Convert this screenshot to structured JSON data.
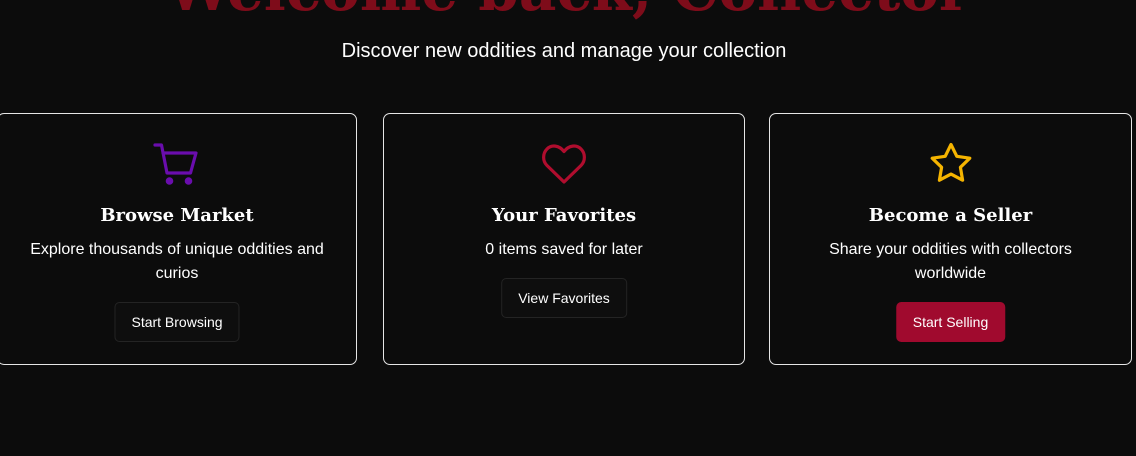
{
  "hero": {
    "title": "Welcome back, Collector",
    "subtitle": "Discover new oddities and manage your collection"
  },
  "colors": {
    "background": "#0c0c0c",
    "title_red": "#7e0c1a",
    "cart_purple": "#6a0dad",
    "heart_red": "#b00d2e",
    "star_gold": "#f5b400",
    "primary_button": "#a00a2e"
  },
  "cards": [
    {
      "icon": "shopping-cart-icon",
      "title": "Browse Market",
      "description": "Explore thousands of unique oddities and curios",
      "button_label": "Start Browsing"
    },
    {
      "icon": "heart-icon",
      "title": "Your Favorites",
      "description": "0 items saved for later",
      "button_label": "View Favorites"
    },
    {
      "icon": "star-icon",
      "title": "Become a Seller",
      "description": "Share your oddities with collectors worldwide",
      "button_label": "Start Selling"
    }
  ]
}
